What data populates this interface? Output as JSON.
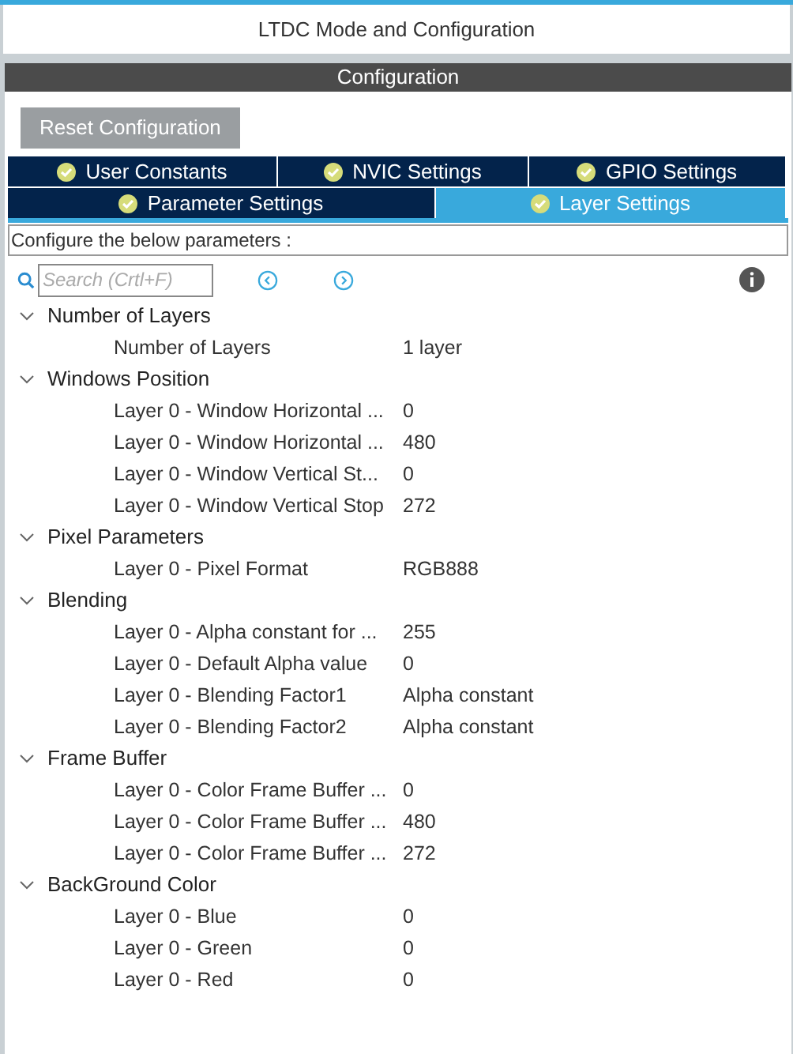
{
  "window": {
    "title": "LTDC Mode and Configuration"
  },
  "section_header": "Configuration",
  "reset_button": "Reset Configuration",
  "tab_rows": [
    [
      {
        "label": "User Constants",
        "selected": false
      },
      {
        "label": "NVIC Settings",
        "selected": false
      },
      {
        "label": "GPIO Settings",
        "selected": false
      }
    ],
    [
      {
        "label": "Parameter Settings",
        "selected": false
      },
      {
        "label": "Layer Settings",
        "selected": true
      }
    ]
  ],
  "description": "Configure the below parameters :",
  "search": {
    "placeholder": "Search (Crtl+F)"
  },
  "groups": [
    {
      "label": "Number of Layers",
      "expanded": true,
      "children": [
        {
          "name": "Number of Layers",
          "value": "1 layer"
        }
      ]
    },
    {
      "label": "Windows Position",
      "expanded": true,
      "children": [
        {
          "name": "Layer 0 - Window Horizontal ...",
          "value": "0"
        },
        {
          "name": "Layer 0 - Window Horizontal ...",
          "value": "480"
        },
        {
          "name": "Layer 0 - Window Vertical St...",
          "value": "0"
        },
        {
          "name": "Layer 0 - Window Vertical Stop",
          "value": "272"
        }
      ]
    },
    {
      "label": "Pixel Parameters",
      "expanded": true,
      "children": [
        {
          "name": "Layer 0 - Pixel Format",
          "value": "RGB888"
        }
      ]
    },
    {
      "label": "Blending",
      "expanded": true,
      "children": [
        {
          "name": "Layer 0 - Alpha constant for ...",
          "value": "255"
        },
        {
          "name": "Layer 0 - Default Alpha value",
          "value": "0"
        },
        {
          "name": "Layer 0 - Blending Factor1",
          "value": "Alpha constant"
        },
        {
          "name": "Layer 0 - Blending Factor2",
          "value": "Alpha constant"
        }
      ]
    },
    {
      "label": "Frame Buffer",
      "expanded": true,
      "children": [
        {
          "name": "Layer 0 - Color Frame Buffer ...",
          "value": "0"
        },
        {
          "name": "Layer 0 - Color Frame Buffer ...",
          "value": "480"
        },
        {
          "name": "Layer 0 - Color Frame Buffer ...",
          "value": "272"
        }
      ]
    },
    {
      "label": "BackGround Color",
      "expanded": true,
      "children": [
        {
          "name": "Layer 0 - Blue",
          "value": "0"
        },
        {
          "name": "Layer 0 - Green",
          "value": "0"
        },
        {
          "name": "Layer 0 - Red",
          "value": "0"
        }
      ]
    }
  ]
}
